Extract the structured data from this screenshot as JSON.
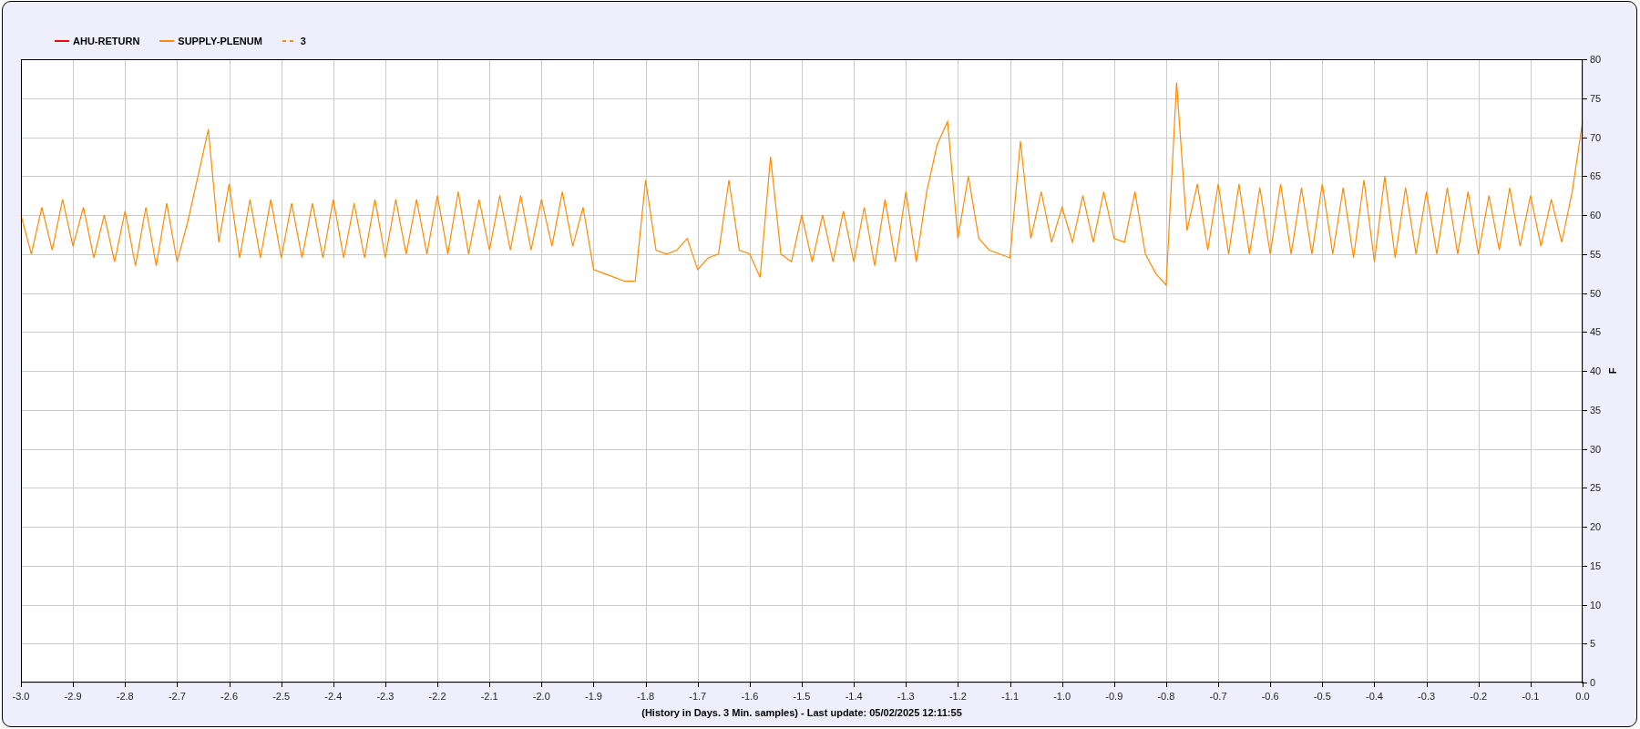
{
  "chart": {
    "chart_data": {
      "type": "line",
      "xlabel": "(History in Days. 3 Min. samples) - Last update: 05/02/2025 12:11:55",
      "ylabel": "F",
      "x": [
        -3.0,
        -2.98,
        -2.96,
        -2.94,
        -2.92,
        -2.9,
        -2.88,
        -2.86,
        -2.84,
        -2.82,
        -2.8,
        -2.78,
        -2.76,
        -2.74,
        -2.72,
        -2.7,
        -2.68,
        -2.66,
        -2.64,
        -2.62,
        -2.6,
        -2.58,
        -2.56,
        -2.54,
        -2.52,
        -2.5,
        -2.48,
        -2.46,
        -2.44,
        -2.42,
        -2.4,
        -2.38,
        -2.36,
        -2.34,
        -2.32,
        -2.3,
        -2.28,
        -2.26,
        -2.24,
        -2.22,
        -2.2,
        -2.18,
        -2.16,
        -2.14,
        -2.12,
        -2.1,
        -2.08,
        -2.06,
        -2.04,
        -2.02,
        -2.0,
        -1.98,
        -1.96,
        -1.94,
        -1.92,
        -1.9,
        -1.88,
        -1.86,
        -1.84,
        -1.82,
        -1.8,
        -1.78,
        -1.76,
        -1.74,
        -1.72,
        -1.7,
        -1.68,
        -1.66,
        -1.64,
        -1.62,
        -1.6,
        -1.58,
        -1.56,
        -1.54,
        -1.52,
        -1.5,
        -1.48,
        -1.46,
        -1.44,
        -1.42,
        -1.4,
        -1.38,
        -1.36,
        -1.34,
        -1.32,
        -1.3,
        -1.28,
        -1.26,
        -1.24,
        -1.22,
        -1.2,
        -1.18,
        -1.16,
        -1.14,
        -1.12,
        -1.1,
        -1.08,
        -1.06,
        -1.04,
        -1.02,
        -1.0,
        -0.98,
        -0.96,
        -0.94,
        -0.92,
        -0.9,
        -0.88,
        -0.86,
        -0.84,
        -0.82,
        -0.8,
        -0.78,
        -0.76,
        -0.74,
        -0.72,
        -0.7,
        -0.68,
        -0.66,
        -0.64,
        -0.62,
        -0.6,
        -0.58,
        -0.56,
        -0.54,
        -0.52,
        -0.5,
        -0.48,
        -0.46,
        -0.44,
        -0.42,
        -0.4,
        -0.38,
        -0.36,
        -0.34,
        -0.32,
        -0.3,
        -0.28,
        -0.26,
        -0.24,
        -0.22,
        -0.2,
        -0.18,
        -0.16,
        -0.14,
        -0.12,
        -0.1,
        -0.08,
        -0.06,
        -0.04,
        -0.02,
        0.0
      ],
      "series": [
        {
          "name": "AHU-RETURN",
          "color": "#ff0000",
          "line_style": "solid",
          "values": [
            null,
            null,
            null,
            null,
            null,
            null,
            null,
            null,
            null,
            null,
            null,
            null,
            null,
            null,
            null,
            null,
            null,
            null,
            null,
            null,
            null,
            null,
            null,
            null,
            null,
            null,
            null,
            null,
            null,
            null,
            null,
            null,
            null,
            null,
            null,
            null,
            null,
            null,
            null,
            null,
            null,
            null,
            null,
            null,
            null,
            null,
            null,
            null,
            null,
            null,
            null,
            null,
            null,
            null,
            null,
            null,
            null,
            null,
            null,
            null,
            null,
            null,
            null,
            null,
            null,
            null,
            null,
            null,
            null,
            null,
            null,
            null,
            null,
            null,
            null,
            null,
            null,
            null,
            null,
            null,
            null,
            null,
            null,
            null,
            null,
            null,
            null,
            null,
            null,
            null,
            null,
            null,
            null,
            null,
            null,
            null,
            null,
            null,
            null,
            null,
            null,
            null,
            null,
            null,
            null,
            null,
            null,
            null,
            null,
            null,
            null,
            null,
            null,
            null,
            null,
            null,
            null,
            null,
            null,
            null,
            null,
            null,
            null,
            null,
            null,
            null,
            null,
            null,
            null,
            null,
            null,
            null,
            null,
            null,
            null,
            null,
            null,
            null,
            null,
            null,
            null,
            null,
            null,
            null,
            null,
            null,
            null,
            null,
            null,
            null,
            null
          ]
        },
        {
          "name": "SUPPLY-PLENUM",
          "color": "#ff8c00",
          "line_style": "solid",
          "values": [
            60,
            55,
            61,
            55.5,
            62,
            56,
            61,
            54.5,
            60,
            54,
            60.5,
            53.5,
            61,
            53.5,
            61.5,
            54,
            59,
            65,
            71,
            56.5,
            64,
            54.5,
            62,
            54.5,
            62,
            54.5,
            61.5,
            54.5,
            61.5,
            54.5,
            62,
            54.5,
            61.5,
            54.5,
            62,
            54.5,
            62,
            55,
            62,
            55,
            62.5,
            55,
            63,
            55,
            62,
            55.5,
            62.5,
            55.5,
            62.5,
            55.5,
            62,
            56,
            63,
            56,
            61,
            53,
            52.5,
            52,
            51.5,
            51.5,
            64.5,
            55.5,
            55,
            55.5,
            57,
            53,
            54.5,
            55,
            64.5,
            55.5,
            55,
            52,
            67.5,
            55,
            54,
            60,
            54,
            60,
            54,
            60.5,
            54,
            61,
            53.5,
            62,
            54,
            63,
            54,
            63,
            69,
            72,
            57,
            65,
            57,
            55.5,
            55,
            54.5,
            69.5,
            57,
            63,
            56.5,
            61,
            56.5,
            62.5,
            56.5,
            63,
            57,
            56.5,
            63,
            55,
            52.5,
            51,
            77,
            58,
            64,
            55.5,
            64,
            55,
            64,
            55,
            63.5,
            55,
            64,
            55,
            63.5,
            55,
            64,
            55,
            63.5,
            54.5,
            64.5,
            54,
            65,
            54.5,
            63.5,
            55,
            63,
            55,
            63.5,
            55,
            63,
            55,
            62.5,
            55.5,
            63.5,
            56,
            62.5,
            56,
            62,
            56.5,
            63,
            72
          ]
        },
        {
          "name": "3",
          "color": "#ff8c00",
          "line_style": "dashed",
          "values": [
            null,
            null,
            null,
            null,
            null,
            null,
            null,
            null,
            null,
            null,
            null,
            null,
            null,
            null,
            null,
            null,
            null,
            null,
            null,
            null,
            null,
            null,
            null,
            null,
            null,
            null,
            null,
            null,
            null,
            null,
            null,
            null,
            null,
            null,
            null,
            null,
            null,
            null,
            null,
            null,
            null,
            null,
            null,
            null,
            null,
            null,
            null,
            null,
            null,
            null,
            null,
            null,
            null,
            null,
            null,
            null,
            null,
            null,
            null,
            null,
            null,
            null,
            null,
            null,
            null,
            null,
            null,
            null,
            null,
            null,
            null,
            null,
            null,
            null,
            null,
            null,
            null,
            null,
            null,
            null,
            null,
            null,
            null,
            null,
            null,
            null,
            null,
            null,
            null,
            null,
            null,
            null,
            null,
            null,
            null,
            null,
            null,
            null,
            null,
            null,
            null,
            null,
            null,
            null,
            null,
            null,
            null,
            null,
            null,
            null,
            null,
            null,
            null,
            null,
            null,
            null,
            null,
            null,
            null,
            null,
            null,
            null,
            null,
            null,
            null,
            null,
            null,
            null,
            null,
            null,
            null,
            null,
            null,
            null,
            null,
            null,
            null,
            null,
            null,
            null,
            null,
            null,
            null,
            null,
            null,
            null,
            null,
            null,
            null,
            null,
            null
          ]
        }
      ],
      "grid": true,
      "xlim": [
        -3.0,
        0.0
      ],
      "ylim": [
        0,
        80
      ],
      "xticks": [
        {
          "value": -3.0,
          "label": "-3.0"
        },
        {
          "value": -2.9,
          "label": "-2.9"
        },
        {
          "value": -2.8,
          "label": "-2.8"
        },
        {
          "value": -2.7,
          "label": "-2.7"
        },
        {
          "value": -2.6,
          "label": "-2.6"
        },
        {
          "value": -2.5,
          "label": "-2.5"
        },
        {
          "value": -2.4,
          "label": "-2.4"
        },
        {
          "value": -2.3,
          "label": "-2.3"
        },
        {
          "value": -2.2,
          "label": "-2.2"
        },
        {
          "value": -2.1,
          "label": "-2.1"
        },
        {
          "value": -2.0,
          "label": "-2.0"
        },
        {
          "value": -1.9,
          "label": "-1.9"
        },
        {
          "value": -1.8,
          "label": "-1.8"
        },
        {
          "value": -1.7,
          "label": "-1.7"
        },
        {
          "value": -1.6,
          "label": "-1.6"
        },
        {
          "value": -1.5,
          "label": "-1.5"
        },
        {
          "value": -1.4,
          "label": "-1.4"
        },
        {
          "value": -1.3,
          "label": "-1.3"
        },
        {
          "value": -1.2,
          "label": "-1.2"
        },
        {
          "value": -1.1,
          "label": "-1.1"
        },
        {
          "value": -1.0,
          "label": "-1.0"
        },
        {
          "value": -0.9,
          "label": "-0.9"
        },
        {
          "value": -0.8,
          "label": "-0.8"
        },
        {
          "value": -0.7,
          "label": "-0.7"
        },
        {
          "value": -0.6,
          "label": "-0.6"
        },
        {
          "value": -0.5,
          "label": "-0.5"
        },
        {
          "value": -0.4,
          "label": "-0.4"
        },
        {
          "value": -0.3,
          "label": "-0.3"
        },
        {
          "value": -0.2,
          "label": "-0.2"
        },
        {
          "value": -0.1,
          "label": "-0.1"
        },
        {
          "value": 0.0,
          "label": "0.0"
        }
      ],
      "yticks": [
        0,
        5,
        10,
        15,
        20,
        25,
        30,
        35,
        40,
        45,
        50,
        55,
        60,
        65,
        70,
        75,
        80
      ]
    }
  }
}
